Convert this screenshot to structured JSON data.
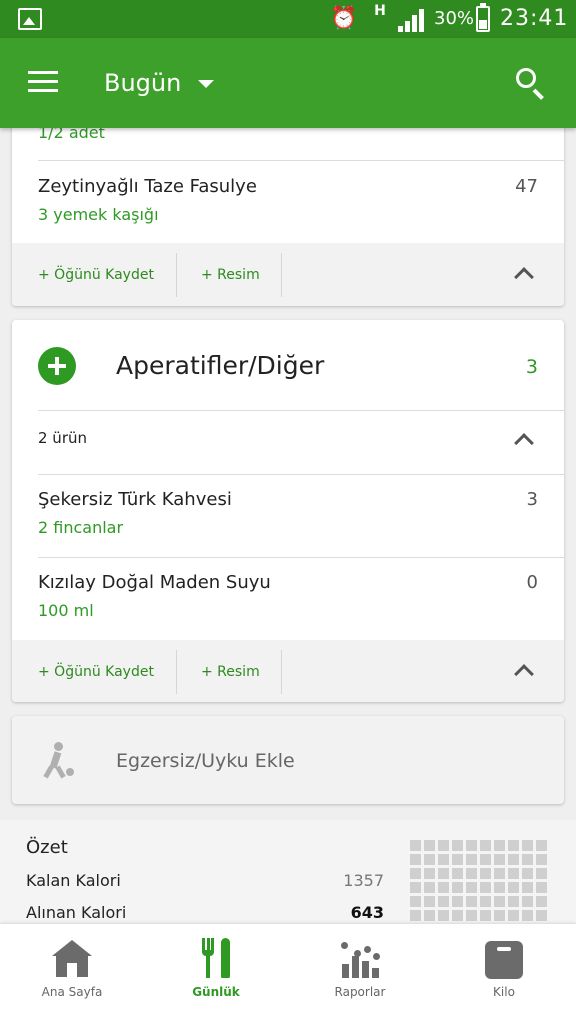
{
  "status_bar": {
    "alarm_icon": "alarm-clock-icon",
    "network": "H",
    "battery": "30%",
    "time": "23:41"
  },
  "app_bar": {
    "title": "Bugün",
    "menu_icon": "hamburger-menu-icon",
    "search_icon": "search-icon",
    "color": "#3ca02a"
  },
  "previous_meal": {
    "partial_amount": "1/2 adet",
    "items": [
      {
        "name": "Zeytinyağlı Taze Fasulye",
        "amount": "3  yemek kaşığı",
        "calories": "47"
      }
    ],
    "save_meal_label": "+ Öğünü Kaydet",
    "photo_label": "+ Resim"
  },
  "snack_meal": {
    "title": "Aperatifler/Diğer",
    "calories": "3",
    "item_count": "2 ürün",
    "items": [
      {
        "name": "Şekersiz Türk Kahvesi",
        "amount": "2  fincanlar",
        "calories": "3"
      },
      {
        "name": "Kızılay Doğal Maden Suyu",
        "amount": "100  ml",
        "calories": "0"
      }
    ],
    "save_meal_label": "+ Öğünü Kaydet",
    "photo_label": "+ Resim"
  },
  "exercise": {
    "label": "Egzersiz/Uyku Ekle",
    "icon": "runner-icon"
  },
  "summary": {
    "title": "Özet",
    "rows": [
      {
        "label": "Kalan Kalori",
        "value": "1357"
      },
      {
        "label": "Alınan Kalori",
        "value": "643"
      }
    ]
  },
  "bottom_nav": {
    "items": [
      {
        "label": "Ana Sayfa",
        "icon": "home-icon"
      },
      {
        "label": "Günlük",
        "icon": "fork-knife-icon"
      },
      {
        "label": "Raporlar",
        "icon": "reports-chart-icon"
      },
      {
        "label": "Kilo",
        "icon": "scale-icon"
      }
    ],
    "active_color": "#2e9a24"
  }
}
